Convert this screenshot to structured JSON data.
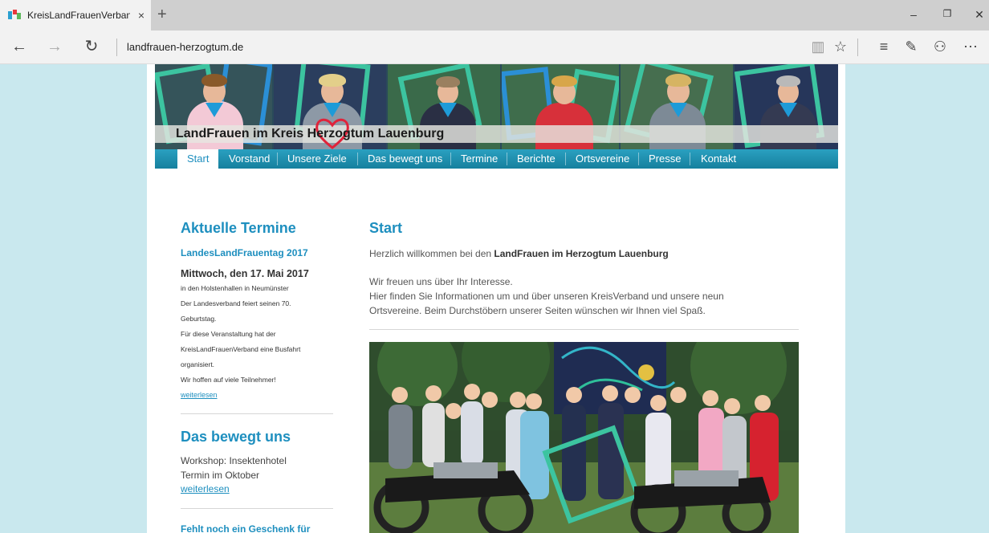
{
  "browser": {
    "tab_title": "KreisLandFrauenVerban",
    "tab_close": "×",
    "new_tab": "+",
    "url": "landfrauen-herzogtum.de",
    "window": {
      "minimize": "–",
      "restore": "❐",
      "close": "✕"
    },
    "nav": {
      "back": "←",
      "forward": "→",
      "refresh": "↻"
    },
    "tools": {
      "reading": "▥",
      "favorite": "☆",
      "hub": "≡",
      "note": "✎",
      "share": "⚇",
      "more": "⋯"
    }
  },
  "site": {
    "banner_title": "LandFrauen im Kreis Herzogtum Lauenburg",
    "nav": [
      "Start",
      "Vorstand",
      "Unsere Ziele",
      "Das bewegt uns",
      "Termine",
      "Berichte",
      "Ortsvereine",
      "Presse",
      "Kontakt"
    ],
    "active_nav": "Start"
  },
  "sidebar": {
    "termine_heading": "Aktuelle Termine",
    "event_title": "LandesLandFrauentag 2017",
    "event_date": "Mittwoch, den 17. Mai 2017",
    "event_lines": [
      "in den Holstenhallen in Neumünster",
      "Der Landesverband feiert seinen 70.",
      "Geburtstag.",
      "Für diese Veranstaltung hat der",
      "KreisLandFrauenVerband eine Busfahrt",
      "organisiert.",
      "Wir hoffen auf viele Teilnehmer!"
    ],
    "event_more": "weiterlesen",
    "bewegt_heading": "Das bewegt uns",
    "bewegt_lines": [
      "Workshop: Insektenhotel",
      "Termin im Oktober"
    ],
    "bewegt_more": "weiterlesen",
    "gift_heading": "Fehlt noch ein Geschenk für"
  },
  "main": {
    "heading": "Start",
    "welcome_prefix": "Herzlich willkommen bei den ",
    "welcome_bold": "LandFrauen im Herzogtum Lauenburg",
    "para_lines": [
      "Wir freuen uns über Ihr Interesse.",
      "Hier finden Sie Informationen um und über unseren KreisVerband und unsere neun",
      "Ortsvereine. Beim Durchstöbern unserer Seiten wünschen wir Ihnen viel Spaß."
    ]
  }
}
